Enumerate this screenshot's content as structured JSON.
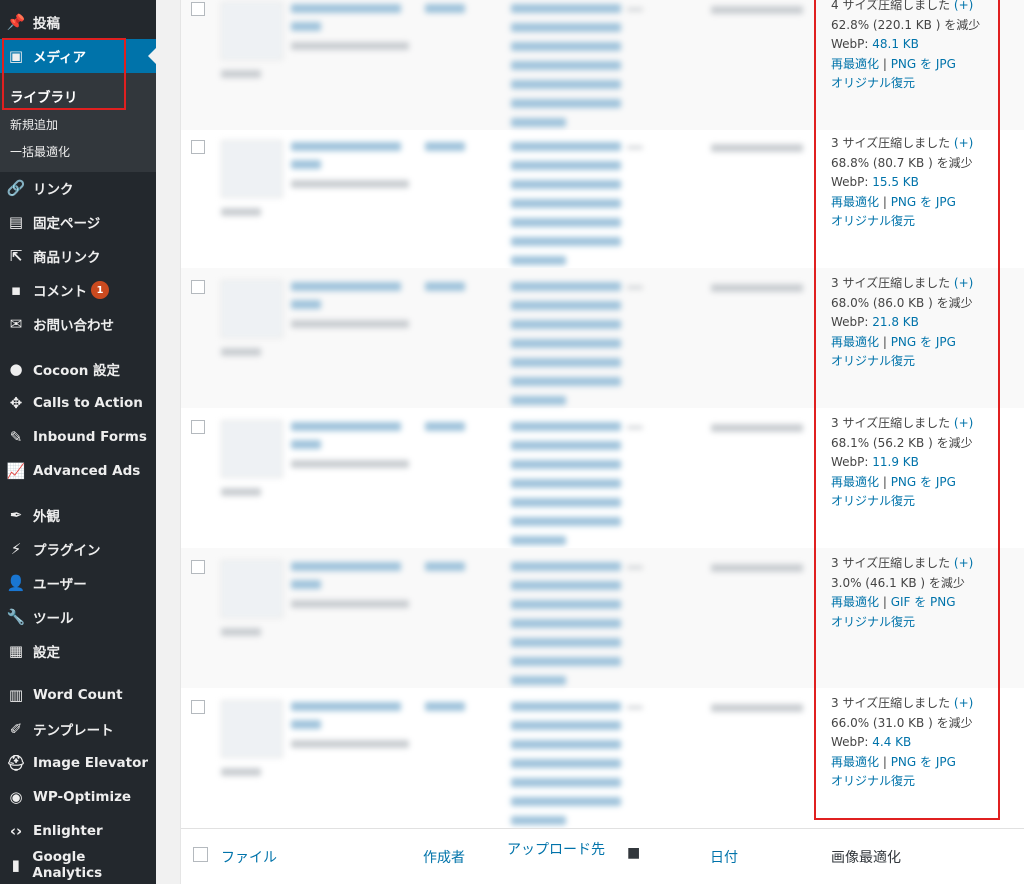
{
  "sidebar": {
    "items": [
      {
        "key": "posts",
        "label": "投稿",
        "icon": "pin-icon"
      },
      {
        "key": "media",
        "label": "メディア",
        "icon": "media-icon"
      },
      {
        "key": "links",
        "label": "リンク",
        "icon": "link-icon"
      },
      {
        "key": "pages",
        "label": "固定ページ",
        "icon": "page-icon"
      },
      {
        "key": "products",
        "label": "商品リンク",
        "icon": "product-link-icon"
      },
      {
        "key": "comments",
        "label": "コメント",
        "icon": "comment-icon",
        "badge": "1"
      },
      {
        "key": "contact",
        "label": "お問い合わせ",
        "icon": "mail-icon"
      },
      {
        "key": "cocoon",
        "label": "Cocoon 設定",
        "icon": "cocoon-icon"
      },
      {
        "key": "cta",
        "label": "Calls to Action",
        "icon": "cta-icon"
      },
      {
        "key": "inbound",
        "label": "Inbound Forms",
        "icon": "form-icon"
      },
      {
        "key": "ads",
        "label": "Advanced Ads",
        "icon": "chart-icon"
      },
      {
        "key": "appearance",
        "label": "外観",
        "icon": "brush-icon"
      },
      {
        "key": "plugins",
        "label": "プラグイン",
        "icon": "plugin-icon"
      },
      {
        "key": "users",
        "label": "ユーザー",
        "icon": "user-icon"
      },
      {
        "key": "tools",
        "label": "ツール",
        "icon": "wrench-icon"
      },
      {
        "key": "settings",
        "label": "設定",
        "icon": "settings-icon"
      },
      {
        "key": "wordcount",
        "label": "Word Count",
        "icon": "wordcount-icon"
      },
      {
        "key": "template",
        "label": "テンプレート",
        "icon": "pen-icon"
      },
      {
        "key": "elevator",
        "label": "Image Elevator",
        "icon": "elevator-icon"
      },
      {
        "key": "wpopt",
        "label": "WP-Optimize",
        "icon": "optimize-icon"
      },
      {
        "key": "enlighter",
        "label": "Enlighter",
        "icon": "code-icon"
      },
      {
        "key": "ga",
        "label": "Google Analytics",
        "icon": "analytics-icon"
      }
    ],
    "submenu": [
      "ライブラリ",
      "新規追加",
      "一括最適化"
    ]
  },
  "rows": [
    {
      "line1_pre": "4 サイズ圧縮しました ",
      "plus": "(+)",
      "line2": "62.8% (220.1 KB ) を減少",
      "webp_label": "WebP: ",
      "webp": "48.1 KB",
      "reopt": "再最適化",
      "conv": "PNG を JPG",
      "restore": "オリジナル復元"
    },
    {
      "line1_pre": "3 サイズ圧縮しました ",
      "plus": "(+)",
      "line2": "68.8% (80.7 KB ) を減少",
      "webp_label": "WebP: ",
      "webp": "15.5 KB",
      "reopt": "再最適化",
      "conv": "PNG を JPG",
      "restore": "オリジナル復元"
    },
    {
      "line1_pre": "3 サイズ圧縮しました ",
      "plus": "(+)",
      "line2": "68.0% (86.0 KB ) を減少",
      "webp_label": "WebP: ",
      "webp": "21.8 KB",
      "reopt": "再最適化",
      "conv": "PNG を JPG",
      "restore": "オリジナル復元"
    },
    {
      "line1_pre": "3 サイズ圧縮しました ",
      "plus": "(+)",
      "line2": "68.1% (56.2 KB ) を減少",
      "webp_label": "WebP: ",
      "webp": "11.9 KB",
      "reopt": "再最適化",
      "conv": "PNG を JPG",
      "restore": "オリジナル復元"
    },
    {
      "line1_pre": "3 サイズ圧縮しました ",
      "plus": "(+)",
      "line2": "3.0% (46.1 KB ) を減少",
      "reopt": "再最適化",
      "conv": "GIF を PNG",
      "restore": "オリジナル復元"
    },
    {
      "line1_pre": "3 サイズ圧縮しました ",
      "plus": "(+)",
      "line2": "66.0% (31.0 KB ) を減少",
      "webp_label": "WebP: ",
      "webp": "4.4 KB",
      "reopt": "再最適化",
      "conv": "PNG を JPG",
      "restore": "オリジナル復元"
    }
  ],
  "footer": {
    "file": "ファイル",
    "author": "作成者",
    "uploaded_to": "アップロード先",
    "date": "日付",
    "optimize": "画像最適化"
  },
  "sep": " | "
}
